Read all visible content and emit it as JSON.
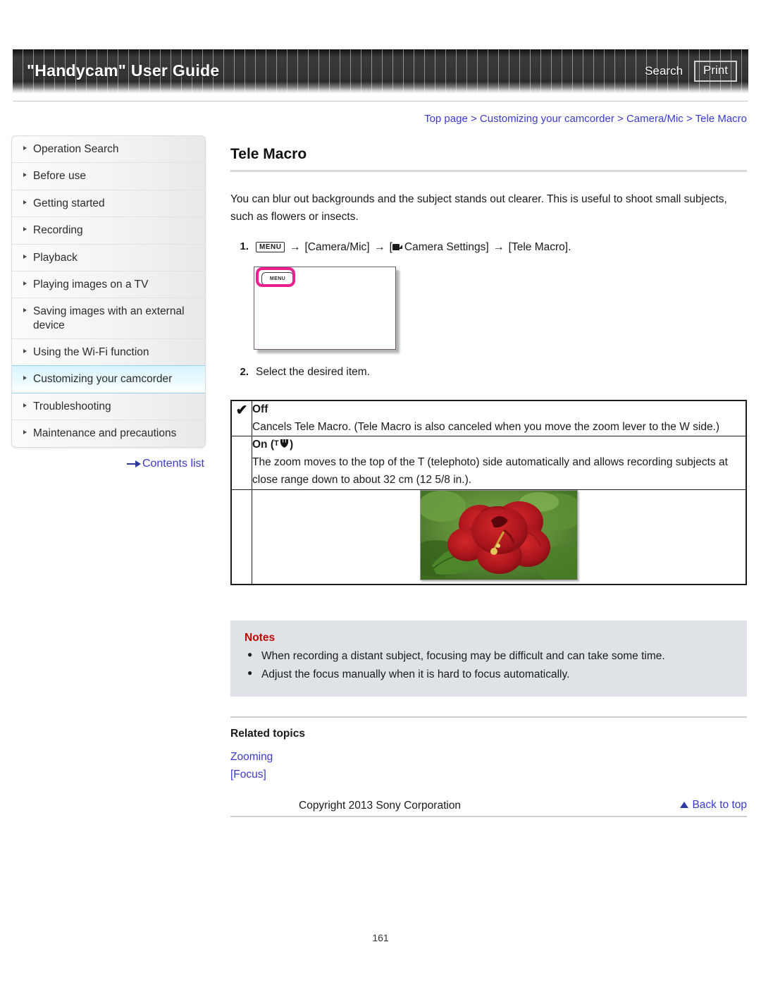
{
  "header": {
    "title": "\"Handycam\" User Guide",
    "search_label": "Search",
    "print_label": "Print"
  },
  "sidebar": {
    "items": [
      {
        "label": "Operation Search",
        "active": false
      },
      {
        "label": "Before use",
        "active": false
      },
      {
        "label": "Getting started",
        "active": false
      },
      {
        "label": "Recording",
        "active": false
      },
      {
        "label": "Playback",
        "active": false
      },
      {
        "label": "Playing images on a TV",
        "active": false
      },
      {
        "label": "Saving images with an external device",
        "active": false
      },
      {
        "label": "Using the Wi-Fi function",
        "active": false
      },
      {
        "label": "Customizing your camcorder",
        "active": true
      },
      {
        "label": "Troubleshooting",
        "active": false
      },
      {
        "label": "Maintenance and precautions",
        "active": false
      }
    ],
    "contents_list_label": "Contents list"
  },
  "breadcrumb": {
    "items": [
      "Top page",
      "Customizing your camcorder",
      "Camera/Mic",
      "Tele Macro"
    ],
    "separator": ">"
  },
  "main": {
    "page_title": "Tele Macro",
    "intro": "You can blur out backgrounds and the subject stands out clearer. This is useful to shoot small subjects, such as flowers or insects.",
    "steps": [
      {
        "number": "1.",
        "menu_chip": "MENU",
        "arrow": "→",
        "part1": "[Camera/Mic]",
        "part2_open": "[",
        "part2_label": "Camera Settings]",
        "part3": "[Tele Macro]."
      },
      {
        "number": "2.",
        "text": "Select the desired item."
      }
    ],
    "illustration": {
      "menu_button_label": "MENU",
      "highlight_color": "#ec1f8f"
    },
    "options_table": {
      "rows": [
        {
          "checked": true,
          "check_glyph": "✔",
          "name": "Off",
          "icon": "",
          "description": "Cancels Tele Macro. (Tele Macro is also canceled when you move the zoom lever to the W side.)"
        },
        {
          "checked": false,
          "check_glyph": "",
          "name": "On",
          "icon": "tele-macro-icon",
          "name_suffix_open": " (",
          "name_suffix_close": ")",
          "description": "The zoom moves to the top of the T (telephoto) side automatically and allows recording subjects at close range down to about 32 cm (12 5/8 in.)."
        }
      ],
      "photo_alt": "red hibiscus flower close-up with green leaves"
    },
    "notes": {
      "title": "Notes",
      "bullet": "●",
      "items": [
        "When recording a distant subject, focusing may be difficult and can take some time.",
        "Adjust the focus manually when it is hard to focus automatically."
      ]
    },
    "related": {
      "title": "Related topics",
      "links": [
        "Zooming",
        "[Focus]"
      ]
    },
    "back_to_top_label": "Back to top"
  },
  "footer": {
    "copyright": "Copyright 2013 Sony Corporation",
    "page_number": "161"
  },
  "colors": {
    "link": "#3a3ad0",
    "notes_title": "#c30000",
    "active_nav": "#d8f4fb",
    "highlight_pink": "#ec1f8f"
  }
}
